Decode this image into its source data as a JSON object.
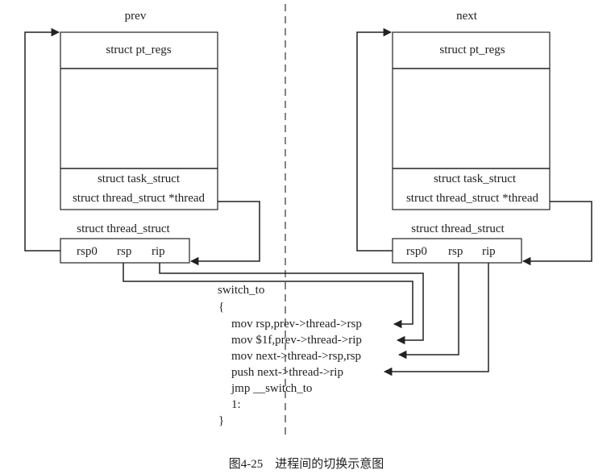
{
  "prev": {
    "title": "prev",
    "pt_regs": "struct pt_regs",
    "task_struct": "struct task_struct",
    "thread_ptr": "struct thread_struct *thread",
    "thread_struct_label": "struct thread_struct",
    "rsp0": "rsp0",
    "rsp": "rsp",
    "rip": "rip"
  },
  "next": {
    "title": "next",
    "pt_regs": "struct pt_regs",
    "task_struct": "struct task_struct",
    "thread_ptr": "struct thread_struct *thread",
    "thread_struct_label": "struct thread_struct",
    "rsp0": "rsp0",
    "rsp": "rsp",
    "rip": "rip"
  },
  "code": {
    "header": "switch_to",
    "open_brace": "{",
    "lines": [
      "mov rsp,prev->thread->rsp",
      "mov $1f,prev->thread->rip",
      "mov next->thread->rsp,rsp",
      "push next->thread->rip",
      "jmp __switch_to",
      "1:"
    ],
    "close_brace": "}"
  },
  "caption": "图4-25　进程间的切换示意图"
}
